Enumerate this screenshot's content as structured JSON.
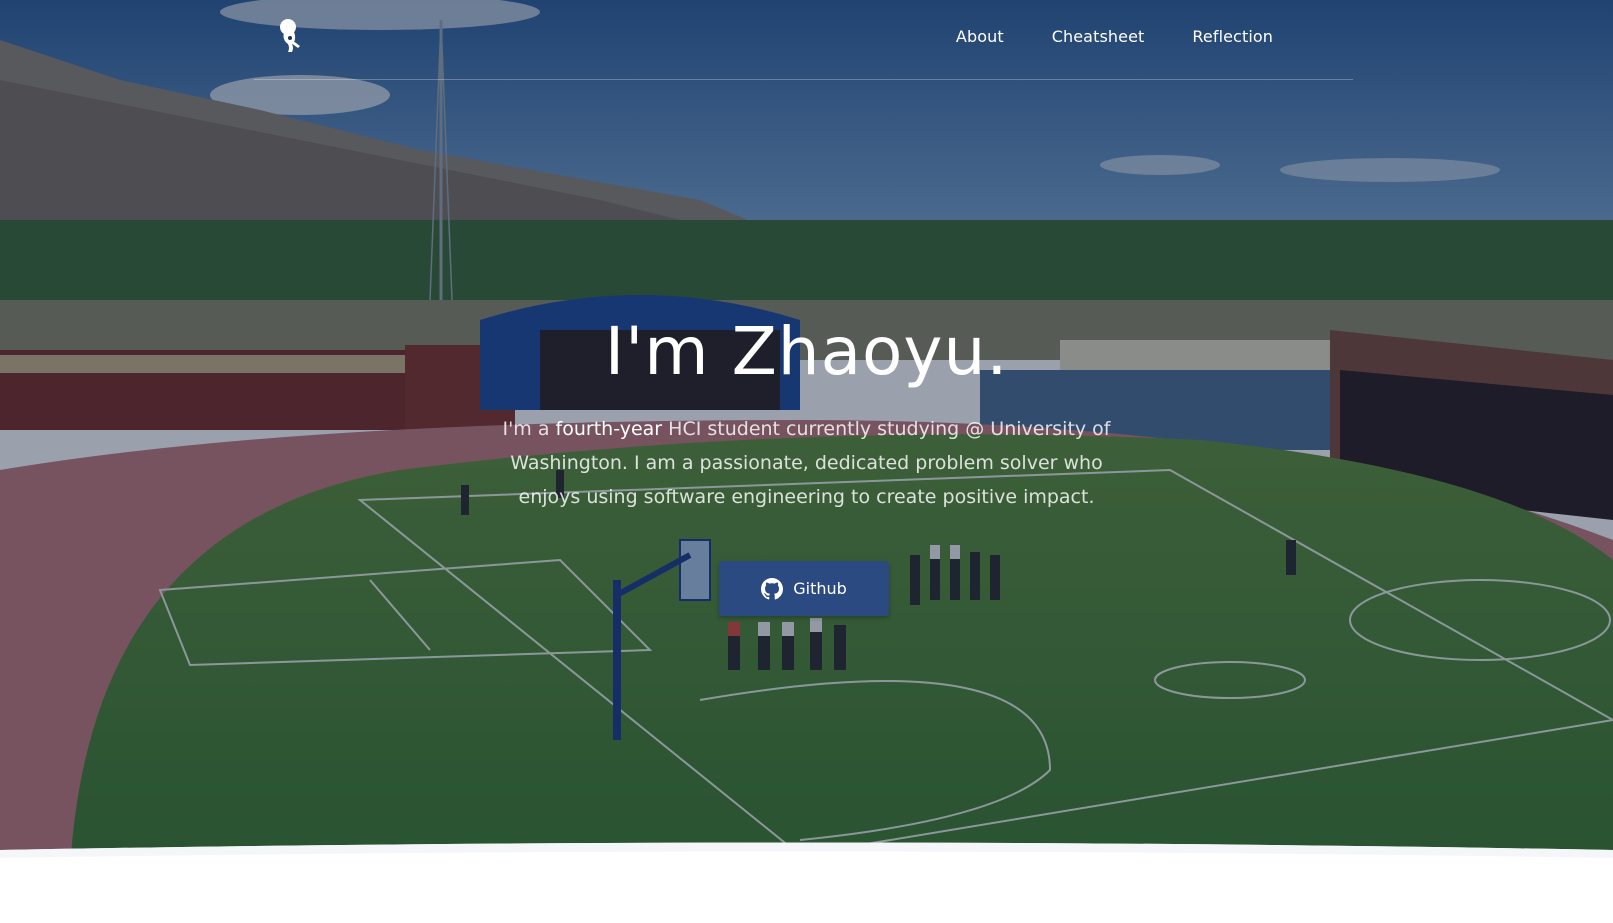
{
  "nav": {
    "logo_icon": "rocket-person-icon",
    "items": [
      {
        "label": "About"
      },
      {
        "label": "Cheatsheet"
      },
      {
        "label": "Reflection"
      }
    ]
  },
  "hero": {
    "title": "I'm Zhaoyu.",
    "intro_prefix": "I'm a ",
    "intro_highlight": "fourth-year",
    "intro_suffix": " HCI student currently studying @ University of Washington. I am a passionate, dedicated problem solver who enjoys using software engineering to create positive impact.",
    "background_icon": "sports-field-photo"
  },
  "cta": {
    "label": "Github",
    "icon": "github-icon"
  },
  "colors": {
    "button": "#2c4a82",
    "overlay": "#0e1c3a",
    "text": "#ffffff"
  }
}
